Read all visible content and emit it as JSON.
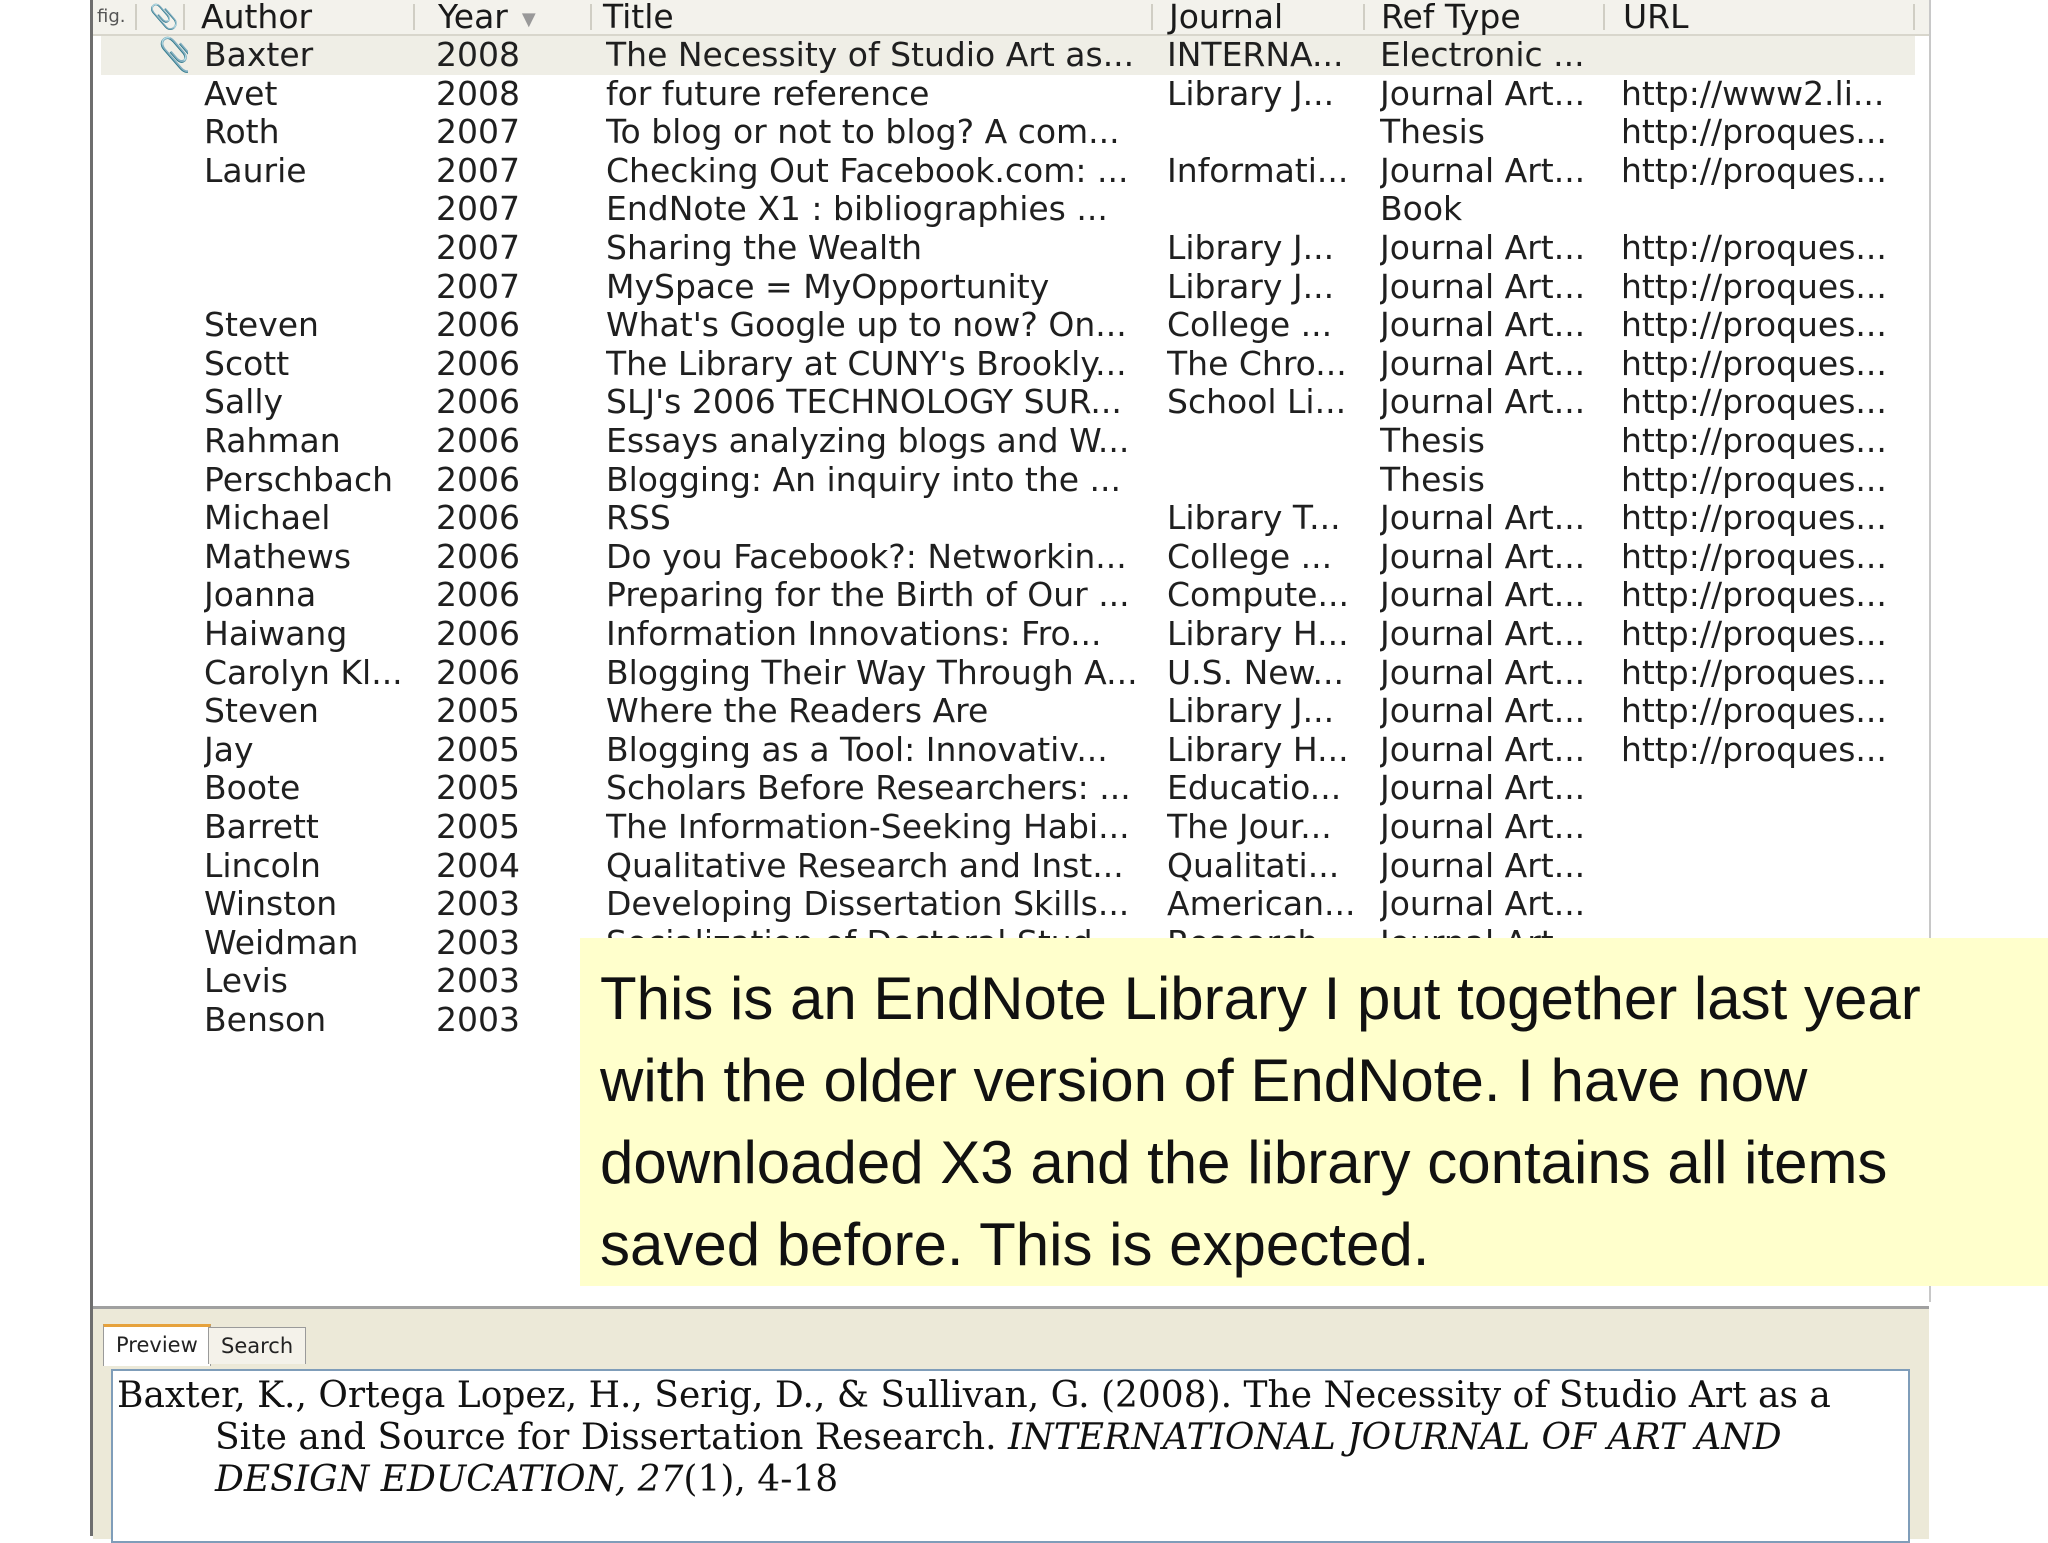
{
  "columns": {
    "figure": "fig.",
    "attachment": "📎",
    "author": "Author",
    "year": "Year",
    "title": "Title",
    "journal": "Journal",
    "ref_type": "Ref Type",
    "url": "URL"
  },
  "rows": [
    {
      "att": "📎",
      "author": "Baxter",
      "year": "2008",
      "title": "The Necessity of Studio Art as...",
      "journal": "INTERNA...",
      "ref_type": "Electronic ...",
      "url": ""
    },
    {
      "att": "",
      "author": "Avet",
      "year": "2008",
      "title": "for future reference",
      "journal": "Library J...",
      "ref_type": "Journal Art...",
      "url": "http://www2.li..."
    },
    {
      "att": "",
      "author": "Roth",
      "year": "2007",
      "title": "To blog or not to blog? A com...",
      "journal": "",
      "ref_type": "Thesis",
      "url": "http://proques..."
    },
    {
      "att": "",
      "author": "Laurie",
      "year": "2007",
      "title": "Checking Out Facebook.com: ...",
      "journal": "Informati...",
      "ref_type": "Journal Art...",
      "url": "http://proques..."
    },
    {
      "att": "",
      "author": "",
      "year": "2007",
      "title": "EndNote X1 : bibliographies ...",
      "journal": "",
      "ref_type": "Book",
      "url": ""
    },
    {
      "att": "",
      "author": "",
      "year": "2007",
      "title": "Sharing the Wealth",
      "journal": "Library J...",
      "ref_type": "Journal Art...",
      "url": "http://proques..."
    },
    {
      "att": "",
      "author": "",
      "year": "2007",
      "title": "MySpace = MyOpportunity",
      "journal": "Library J...",
      "ref_type": "Journal Art...",
      "url": "http://proques..."
    },
    {
      "att": "",
      "author": "Steven",
      "year": "2006",
      "title": "What's Google up to now? On...",
      "journal": "College ...",
      "ref_type": "Journal Art...",
      "url": "http://proques..."
    },
    {
      "att": "",
      "author": "Scott",
      "year": "2006",
      "title": "The Library at CUNY's Brookly...",
      "journal": "The Chro...",
      "ref_type": "Journal Art...",
      "url": "http://proques..."
    },
    {
      "att": "",
      "author": "Sally",
      "year": "2006",
      "title": "SLJ's 2006 TECHNOLOGY SUR...",
      "journal": "School Li...",
      "ref_type": "Journal Art...",
      "url": "http://proques..."
    },
    {
      "att": "",
      "author": "Rahman",
      "year": "2006",
      "title": "Essays analyzing blogs and W...",
      "journal": "",
      "ref_type": "Thesis",
      "url": "http://proques..."
    },
    {
      "att": "",
      "author": "Perschbach",
      "year": "2006",
      "title": "Blogging: An inquiry into the ...",
      "journal": "",
      "ref_type": "Thesis",
      "url": "http://proques..."
    },
    {
      "att": "",
      "author": "Michael",
      "year": "2006",
      "title": "RSS",
      "journal": "Library T...",
      "ref_type": "Journal Art...",
      "url": "http://proques..."
    },
    {
      "att": "",
      "author": "Mathews",
      "year": "2006",
      "title": "Do you Facebook?: Networkin...",
      "journal": "College ...",
      "ref_type": "Journal Art...",
      "url": "http://proques..."
    },
    {
      "att": "",
      "author": "Joanna",
      "year": "2006",
      "title": "Preparing for the Birth of Our ...",
      "journal": "Compute...",
      "ref_type": "Journal Art...",
      "url": "http://proques..."
    },
    {
      "att": "",
      "author": "Haiwang",
      "year": "2006",
      "title": "Information Innovations: Fro...",
      "journal": "Library H...",
      "ref_type": "Journal Art...",
      "url": "http://proques..."
    },
    {
      "att": "",
      "author": "Carolyn Kl...",
      "year": "2006",
      "title": "Blogging Their Way Through A...",
      "journal": "U.S. New...",
      "ref_type": "Journal Art...",
      "url": "http://proques..."
    },
    {
      "att": "",
      "author": "Steven",
      "year": "2005",
      "title": "Where the Readers Are",
      "journal": "Library J...",
      "ref_type": "Journal Art...",
      "url": "http://proques..."
    },
    {
      "att": "",
      "author": "Jay",
      "year": "2005",
      "title": "Blogging as a Tool: Innovativ...",
      "journal": "Library H...",
      "ref_type": "Journal Art...",
      "url": "http://proques..."
    },
    {
      "att": "",
      "author": "Boote",
      "year": "2005",
      "title": "Scholars Before Researchers: ...",
      "journal": "Educatio...",
      "ref_type": "Journal Art...",
      "url": ""
    },
    {
      "att": "",
      "author": "Barrett",
      "year": "2005",
      "title": "The Information-Seeking Habi...",
      "journal": "The Jour...",
      "ref_type": "Journal Art...",
      "url": ""
    },
    {
      "att": "",
      "author": "Lincoln",
      "year": "2004",
      "title": "Qualitative Research and Inst...",
      "journal": "Qualitati...",
      "ref_type": "Journal Art...",
      "url": ""
    },
    {
      "att": "",
      "author": "Winston",
      "year": "2003",
      "title": "Developing Dissertation Skills...",
      "journal": "American...",
      "ref_type": "Journal Art...",
      "url": ""
    },
    {
      "att": "",
      "author": "Weidman",
      "year": "2003",
      "title": "Socialization of Doctoral Stud...",
      "journal": "Research...",
      "ref_type": "Journal Art...",
      "url": ""
    },
    {
      "att": "",
      "author": "Levis",
      "year": "2003",
      "title": "",
      "journal": "",
      "ref_type": "",
      "url": ""
    },
    {
      "att": "",
      "author": "Benson",
      "year": "2003",
      "title": "",
      "journal": "",
      "ref_type": "",
      "url": ""
    }
  ],
  "tabs": {
    "preview": "Preview",
    "search": "Search"
  },
  "preview": {
    "line1": "Baxter, K., Ortega Lopez, H., Serig, D., & Sullivan, G. (2008). The Necessity of Studio Art as a",
    "line2_plain": "Site and Source for Dissertation Research. ",
    "line2_italic": "INTERNATIONAL JOURNAL OF ART AND",
    "line3_italic": "DESIGN EDUCATION, 27",
    "line3_plain": "(1), 4-18"
  },
  "note": {
    "text": "This is an EndNote Library I put together last year with the older version of EndNote. I have now downloaded X3 and the library contains all items saved before. This is expected."
  },
  "colors": {
    "selected_row": "#efeee6",
    "note_bg": "#ffffcc",
    "tab_accent": "#e6a23c"
  }
}
